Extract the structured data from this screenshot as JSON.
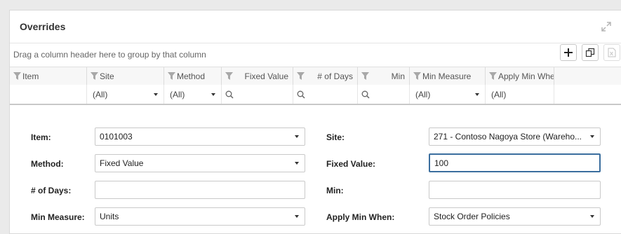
{
  "panel": {
    "title": "Overrides",
    "group_hint": "Drag a column header here to group by that column"
  },
  "toolbar": {
    "add_icon": "plus-icon",
    "copy_icon": "copy-icon",
    "export_icon": "excel-export-icon"
  },
  "grid": {
    "columns": [
      {
        "label": "Item",
        "filter": ""
      },
      {
        "label": "Site",
        "filter": "(All)"
      },
      {
        "label": "Method",
        "filter": "(All)"
      },
      {
        "label": "Fixed Value",
        "filter": ""
      },
      {
        "label": "# of Days",
        "filter": ""
      },
      {
        "label": "Min",
        "filter": ""
      },
      {
        "label": "Min Measure",
        "filter": "(All)"
      },
      {
        "label": "Apply Min When",
        "filter": "(All)"
      }
    ]
  },
  "form": {
    "item": {
      "label": "Item:",
      "value": "0101003"
    },
    "site": {
      "label": "Site:",
      "value": "271 - Contoso Nagoya Store (Wareho..."
    },
    "method": {
      "label": "Method:",
      "value": "Fixed Value"
    },
    "fixed_value": {
      "label": "Fixed Value:",
      "value": "100"
    },
    "days": {
      "label": "# of Days:",
      "value": ""
    },
    "min": {
      "label": "Min:",
      "value": ""
    },
    "min_measure": {
      "label": "Min Measure:",
      "value": "Units"
    },
    "apply_min_when": {
      "label": "Apply Min When:",
      "value": "Stock Order Policies"
    }
  }
}
